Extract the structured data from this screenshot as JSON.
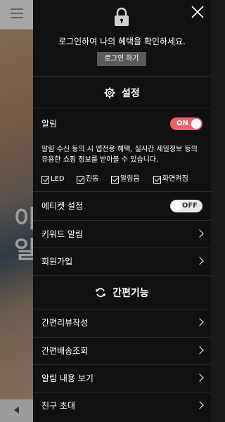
{
  "login": {
    "message": "로그인하여 나의 혜택을 확인하세요.",
    "button_label": "로그인 하기"
  },
  "settings": {
    "title": "설정",
    "icon": "gear-icon",
    "alarm": {
      "label": "알림",
      "toggle_text": "ON",
      "state": "on",
      "description": "알림 수신 동의 시 앱전용 혜택, 실시간 세일정보 등의 유용한 쇼핑 정보를 받아볼 수 있습니다.",
      "options": [
        {
          "label": "LED",
          "checked": true
        },
        {
          "label": "진동",
          "checked": true
        },
        {
          "label": "알림음",
          "checked": true
        },
        {
          "label": "화면켜짐",
          "checked": true
        }
      ]
    },
    "etiquette": {
      "label": "에티켓 설정",
      "toggle_text": "OFF",
      "state": "off"
    },
    "keyword_alarm_label": "키워드 알림",
    "signup_label": "회원가입"
  },
  "quick": {
    "title": "간편기능",
    "icon": "refresh-icon",
    "items": [
      {
        "label": "간편리뷰작성"
      },
      {
        "label": "간편배송조회"
      },
      {
        "label": "알림 내용 보기"
      },
      {
        "label": "친구 초대"
      }
    ]
  },
  "background": {
    "banner_text": "이\n일"
  },
  "colors": {
    "drawer_bg": "#111111",
    "toggle_on": "#ef5f6c",
    "toggle_off": "#e8e8e8",
    "login_button_bg": "#5a5a5a"
  }
}
